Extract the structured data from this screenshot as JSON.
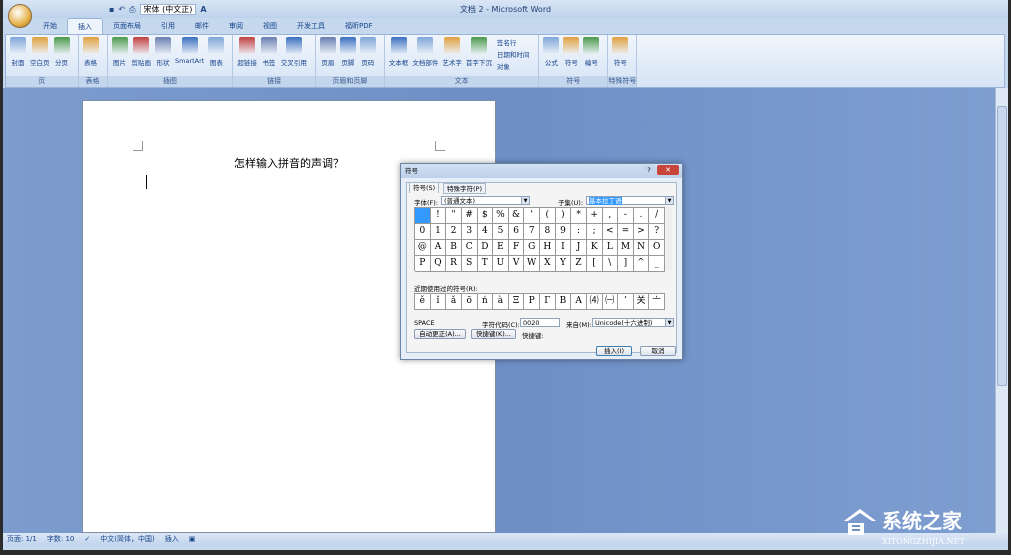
{
  "window": {
    "title": "文档 2 - Microsoft Word"
  },
  "qat": {
    "font_name": "宋体 (中文正)",
    "font_size_icon": "A"
  },
  "tabs": [
    "开始",
    "插入",
    "页面布局",
    "引用",
    "邮件",
    "审阅",
    "视图",
    "开发工具",
    "福昕PDF"
  ],
  "active_tab": "插入",
  "ribbon": {
    "groups": [
      {
        "label": "页",
        "buttons": [
          "封面",
          "空白页",
          "分页"
        ]
      },
      {
        "label": "表格",
        "buttons": [
          "表格"
        ]
      },
      {
        "label": "插图",
        "buttons": [
          "图片",
          "剪贴画",
          "形状",
          "SmartArt",
          "图表"
        ]
      },
      {
        "label": "链接",
        "buttons": [
          "超链接",
          "书签",
          "交叉引用"
        ]
      },
      {
        "label": "页眉和页脚",
        "buttons": [
          "页眉",
          "页脚",
          "页码"
        ]
      },
      {
        "label": "文本",
        "buttons": [
          "文本框",
          "文档部件",
          "艺术字",
          "首字下沉"
        ],
        "small": [
          "签名行",
          "日期和时间",
          "对象"
        ]
      },
      {
        "label": "符号",
        "buttons": [
          "公式",
          "符号",
          "编号"
        ]
      },
      {
        "label": "特殊符号",
        "buttons": [
          "符号"
        ]
      }
    ]
  },
  "document": {
    "heading": "怎样输入拼音的声调？"
  },
  "status": {
    "page": "页面: 1/1",
    "words": "字数: 10",
    "language": "中文(简体，中国)",
    "mode": "插入"
  },
  "dialog": {
    "title": "符号",
    "tabs": [
      "符号(S)",
      "特殊字符(P)"
    ],
    "font_label": "字体(F):",
    "font_value": "(普通文本)",
    "subset_label": "子集(U):",
    "subset_value": "基本拉丁语",
    "grid": [
      " ",
      "!",
      "\"",
      "#",
      "$",
      "%",
      "&",
      "'",
      "(",
      ")",
      "*",
      "+",
      ",",
      "-",
      ".",
      "/",
      "0",
      "1",
      "2",
      "3",
      "4",
      "5",
      "6",
      "7",
      "8",
      "9",
      ":",
      ";",
      "<",
      "=",
      ">",
      "?",
      "@",
      "A",
      "B",
      "C",
      "D",
      "E",
      "F",
      "G",
      "H",
      "I",
      "J",
      "K",
      "L",
      "M",
      "N",
      "O",
      "P",
      "Q",
      "R",
      "S",
      "T",
      "U",
      "V",
      "W",
      "X",
      "Y",
      "Z",
      "[",
      "\\",
      "]",
      "^",
      "_"
    ],
    "recent_label": "近期使用过的符号(R):",
    "recent": [
      "ě",
      "ǐ",
      "ǎ",
      "ō",
      "ń",
      "à",
      "Ξ",
      "Ρ",
      "Γ",
      "Β",
      "Α",
      "⑷",
      "㈠",
      "’",
      "关",
      "〦"
    ],
    "char_name": "SPACE",
    "code_label": "字符代码(C):",
    "code_value": "0020",
    "from_label": "来自(M):",
    "from_value": "Unicode(十六进制)",
    "autocorrect": "自动更正(A)...",
    "shortcut_key": "快捷键(K)...",
    "shortcut_label": "快捷键:",
    "insert": "插入(I)",
    "cancel": "取消"
  },
  "watermark": {
    "text": "系统之家",
    "url": "XITONGZHIJIA.NET"
  }
}
